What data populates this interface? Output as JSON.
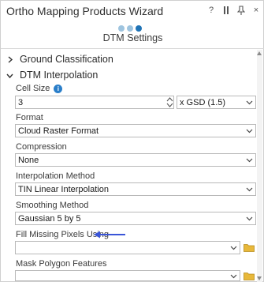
{
  "window": {
    "title": "Ortho Mapping Products Wizard",
    "controls": [
      "?",
      "…",
      "↓",
      "×"
    ]
  },
  "steps": {
    "count": 3,
    "current": 3,
    "title": "DTM Settings"
  },
  "sections": {
    "ground": {
      "label": "Ground Classification",
      "expanded": false
    },
    "dtm": {
      "label": "DTM Interpolation",
      "expanded": true
    }
  },
  "fields": {
    "cell_size": {
      "label": "Cell Size",
      "value": "3",
      "unit": "x GSD (1.5)"
    },
    "format": {
      "label": "Format",
      "value": "Cloud Raster Format"
    },
    "compression": {
      "label": "Compression",
      "value": "None"
    },
    "interpolation": {
      "label": "Interpolation Method",
      "value": "TIN Linear Interpolation"
    },
    "smoothing": {
      "label": "Smoothing Method",
      "value": "Gaussian 5 by 5"
    },
    "fill_missing": {
      "label": "Fill Missing Pixels Using",
      "value": ""
    },
    "mask_polygon": {
      "label": "Mask Polygon Features",
      "value": ""
    }
  },
  "colors": {
    "accent": "#1f73b6",
    "step_inactive": "#9ec4df",
    "annotation_arrow": "#3a55d8",
    "folder": "#e8b83a"
  },
  "icons": {
    "info": "info-icon",
    "folder": "folder-icon",
    "dropdown": "chevron-down-icon"
  }
}
